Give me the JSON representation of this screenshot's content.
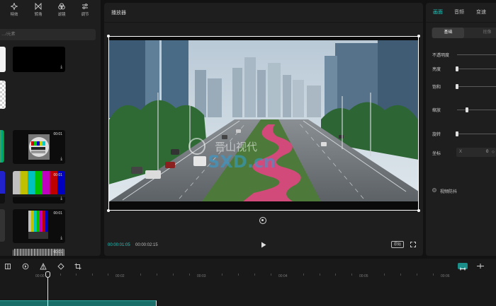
{
  "left_toolbar": {
    "effects": "特效",
    "transitions": "转场",
    "filters": "滤镜",
    "adjust": "调节"
  },
  "search": {
    "placeholder": "…/元素"
  },
  "media": [
    {
      "duration": "",
      "icon": "download-icon"
    },
    {
      "duration": "00:01",
      "icon": "download-icon"
    },
    {
      "duration": "00:01",
      "icon": "download-icon"
    },
    {
      "duration": "00:01",
      "icon": "download-icon"
    },
    {
      "duration": "00:01",
      "icon": "download-icon"
    }
  ],
  "player": {
    "title": "播放器",
    "current_time": "00:00:01:05",
    "total_time": "00:00:02:15",
    "ratio_label": "原始",
    "watermark_cn": "晋山视代",
    "watermark_en": "SXD.cn"
  },
  "properties": {
    "tabs": [
      "画面",
      "音频",
      "变速"
    ],
    "subtabs": [
      "基础",
      "抠像"
    ],
    "opacity_label": "不透明度",
    "opacity": 1.0,
    "rows": [
      {
        "label": "亮度",
        "level": 0.02
      },
      {
        "label": "饱和",
        "level": 0.02
      },
      {
        "label": "缩放",
        "level": 0.25
      },
      {
        "label": "旋转",
        "level": 0.02
      }
    ],
    "coord_label": "坐标",
    "coord_axis": "X",
    "coord_value": "0",
    "stabilize_label": "视频防抖"
  },
  "timeline": {
    "ticks": [
      "00:00",
      "00:02",
      "00:03",
      "00:04",
      "00:05",
      "00:06"
    ]
  },
  "colors": {
    "accent": "#20c9c0",
    "panel": "#1e1e1e",
    "background": "#121212",
    "clip": "#1a6e6a"
  }
}
